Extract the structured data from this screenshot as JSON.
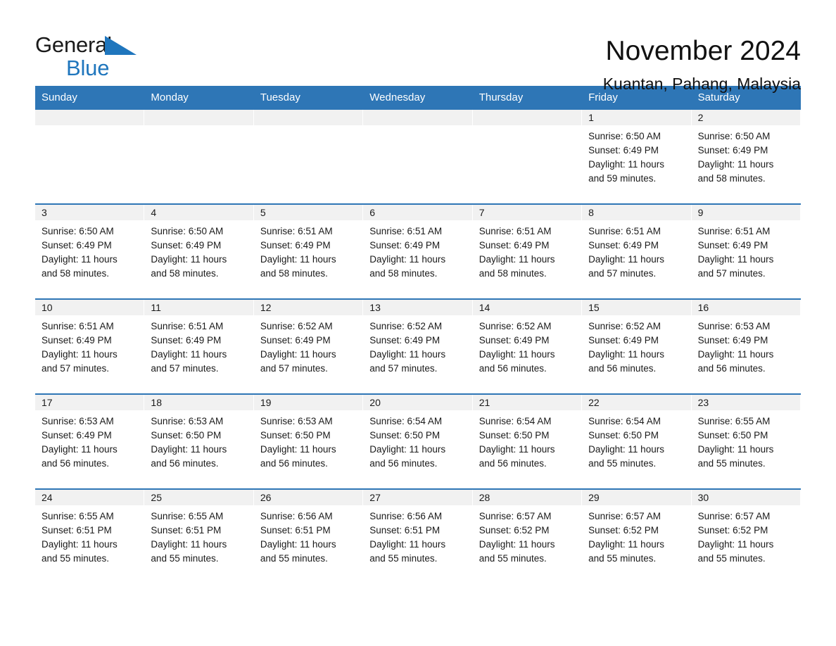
{
  "brand": {
    "name_part1": "General",
    "name_part2": "Blue",
    "triangle_icon": "blue-triangle-logo-mark",
    "accent_color": "#1f76bd"
  },
  "header": {
    "title": "November 2024",
    "subtitle": "Kuantan, Pahang, Malaysia"
  },
  "calendar": {
    "header_bg": "#2e76b6",
    "daynum_bg": "#f1f1f1",
    "weekdays": [
      "Sunday",
      "Monday",
      "Tuesday",
      "Wednesday",
      "Thursday",
      "Friday",
      "Saturday"
    ],
    "weeks": [
      [
        {
          "day": "",
          "sunrise": "",
          "sunset": "",
          "daylight1": "",
          "daylight2": ""
        },
        {
          "day": "",
          "sunrise": "",
          "sunset": "",
          "daylight1": "",
          "daylight2": ""
        },
        {
          "day": "",
          "sunrise": "",
          "sunset": "",
          "daylight1": "",
          "daylight2": ""
        },
        {
          "day": "",
          "sunrise": "",
          "sunset": "",
          "daylight1": "",
          "daylight2": ""
        },
        {
          "day": "",
          "sunrise": "",
          "sunset": "",
          "daylight1": "",
          "daylight2": ""
        },
        {
          "day": "1",
          "sunrise": "Sunrise: 6:50 AM",
          "sunset": "Sunset: 6:49 PM",
          "daylight1": "Daylight: 11 hours",
          "daylight2": "and 59 minutes."
        },
        {
          "day": "2",
          "sunrise": "Sunrise: 6:50 AM",
          "sunset": "Sunset: 6:49 PM",
          "daylight1": "Daylight: 11 hours",
          "daylight2": "and 58 minutes."
        }
      ],
      [
        {
          "day": "3",
          "sunrise": "Sunrise: 6:50 AM",
          "sunset": "Sunset: 6:49 PM",
          "daylight1": "Daylight: 11 hours",
          "daylight2": "and 58 minutes."
        },
        {
          "day": "4",
          "sunrise": "Sunrise: 6:50 AM",
          "sunset": "Sunset: 6:49 PM",
          "daylight1": "Daylight: 11 hours",
          "daylight2": "and 58 minutes."
        },
        {
          "day": "5",
          "sunrise": "Sunrise: 6:51 AM",
          "sunset": "Sunset: 6:49 PM",
          "daylight1": "Daylight: 11 hours",
          "daylight2": "and 58 minutes."
        },
        {
          "day": "6",
          "sunrise": "Sunrise: 6:51 AM",
          "sunset": "Sunset: 6:49 PM",
          "daylight1": "Daylight: 11 hours",
          "daylight2": "and 58 minutes."
        },
        {
          "day": "7",
          "sunrise": "Sunrise: 6:51 AM",
          "sunset": "Sunset: 6:49 PM",
          "daylight1": "Daylight: 11 hours",
          "daylight2": "and 58 minutes."
        },
        {
          "day": "8",
          "sunrise": "Sunrise: 6:51 AM",
          "sunset": "Sunset: 6:49 PM",
          "daylight1": "Daylight: 11 hours",
          "daylight2": "and 57 minutes."
        },
        {
          "day": "9",
          "sunrise": "Sunrise: 6:51 AM",
          "sunset": "Sunset: 6:49 PM",
          "daylight1": "Daylight: 11 hours",
          "daylight2": "and 57 minutes."
        }
      ],
      [
        {
          "day": "10",
          "sunrise": "Sunrise: 6:51 AM",
          "sunset": "Sunset: 6:49 PM",
          "daylight1": "Daylight: 11 hours",
          "daylight2": "and 57 minutes."
        },
        {
          "day": "11",
          "sunrise": "Sunrise: 6:51 AM",
          "sunset": "Sunset: 6:49 PM",
          "daylight1": "Daylight: 11 hours",
          "daylight2": "and 57 minutes."
        },
        {
          "day": "12",
          "sunrise": "Sunrise: 6:52 AM",
          "sunset": "Sunset: 6:49 PM",
          "daylight1": "Daylight: 11 hours",
          "daylight2": "and 57 minutes."
        },
        {
          "day": "13",
          "sunrise": "Sunrise: 6:52 AM",
          "sunset": "Sunset: 6:49 PM",
          "daylight1": "Daylight: 11 hours",
          "daylight2": "and 57 minutes."
        },
        {
          "day": "14",
          "sunrise": "Sunrise: 6:52 AM",
          "sunset": "Sunset: 6:49 PM",
          "daylight1": "Daylight: 11 hours",
          "daylight2": "and 56 minutes."
        },
        {
          "day": "15",
          "sunrise": "Sunrise: 6:52 AM",
          "sunset": "Sunset: 6:49 PM",
          "daylight1": "Daylight: 11 hours",
          "daylight2": "and 56 minutes."
        },
        {
          "day": "16",
          "sunrise": "Sunrise: 6:53 AM",
          "sunset": "Sunset: 6:49 PM",
          "daylight1": "Daylight: 11 hours",
          "daylight2": "and 56 minutes."
        }
      ],
      [
        {
          "day": "17",
          "sunrise": "Sunrise: 6:53 AM",
          "sunset": "Sunset: 6:49 PM",
          "daylight1": "Daylight: 11 hours",
          "daylight2": "and 56 minutes."
        },
        {
          "day": "18",
          "sunrise": "Sunrise: 6:53 AM",
          "sunset": "Sunset: 6:50 PM",
          "daylight1": "Daylight: 11 hours",
          "daylight2": "and 56 minutes."
        },
        {
          "day": "19",
          "sunrise": "Sunrise: 6:53 AM",
          "sunset": "Sunset: 6:50 PM",
          "daylight1": "Daylight: 11 hours",
          "daylight2": "and 56 minutes."
        },
        {
          "day": "20",
          "sunrise": "Sunrise: 6:54 AM",
          "sunset": "Sunset: 6:50 PM",
          "daylight1": "Daylight: 11 hours",
          "daylight2": "and 56 minutes."
        },
        {
          "day": "21",
          "sunrise": "Sunrise: 6:54 AM",
          "sunset": "Sunset: 6:50 PM",
          "daylight1": "Daylight: 11 hours",
          "daylight2": "and 56 minutes."
        },
        {
          "day": "22",
          "sunrise": "Sunrise: 6:54 AM",
          "sunset": "Sunset: 6:50 PM",
          "daylight1": "Daylight: 11 hours",
          "daylight2": "and 55 minutes."
        },
        {
          "day": "23",
          "sunrise": "Sunrise: 6:55 AM",
          "sunset": "Sunset: 6:50 PM",
          "daylight1": "Daylight: 11 hours",
          "daylight2": "and 55 minutes."
        }
      ],
      [
        {
          "day": "24",
          "sunrise": "Sunrise: 6:55 AM",
          "sunset": "Sunset: 6:51 PM",
          "daylight1": "Daylight: 11 hours",
          "daylight2": "and 55 minutes."
        },
        {
          "day": "25",
          "sunrise": "Sunrise: 6:55 AM",
          "sunset": "Sunset: 6:51 PM",
          "daylight1": "Daylight: 11 hours",
          "daylight2": "and 55 minutes."
        },
        {
          "day": "26",
          "sunrise": "Sunrise: 6:56 AM",
          "sunset": "Sunset: 6:51 PM",
          "daylight1": "Daylight: 11 hours",
          "daylight2": "and 55 minutes."
        },
        {
          "day": "27",
          "sunrise": "Sunrise: 6:56 AM",
          "sunset": "Sunset: 6:51 PM",
          "daylight1": "Daylight: 11 hours",
          "daylight2": "and 55 minutes."
        },
        {
          "day": "28",
          "sunrise": "Sunrise: 6:57 AM",
          "sunset": "Sunset: 6:52 PM",
          "daylight1": "Daylight: 11 hours",
          "daylight2": "and 55 minutes."
        },
        {
          "day": "29",
          "sunrise": "Sunrise: 6:57 AM",
          "sunset": "Sunset: 6:52 PM",
          "daylight1": "Daylight: 11 hours",
          "daylight2": "and 55 minutes."
        },
        {
          "day": "30",
          "sunrise": "Sunrise: 6:57 AM",
          "sunset": "Sunset: 6:52 PM",
          "daylight1": "Daylight: 11 hours",
          "daylight2": "and 55 minutes."
        }
      ]
    ]
  }
}
